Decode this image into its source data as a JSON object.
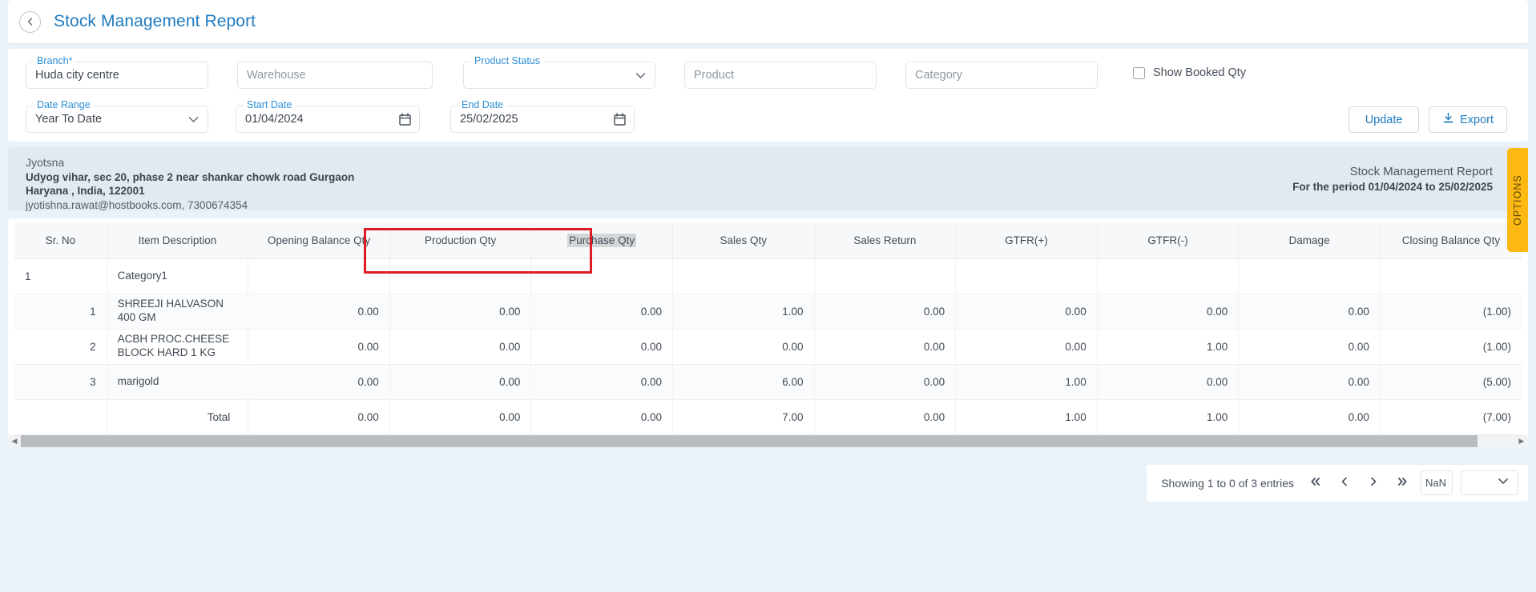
{
  "header": {
    "title": "Stock Management Report",
    "back_icon": "chevron-left-icon"
  },
  "filters": {
    "branch": {
      "label": "Branch",
      "required": "*",
      "value": "Huda city centre"
    },
    "warehouse": {
      "placeholder": "Warehouse",
      "value": ""
    },
    "product_status": {
      "label": "Product Status",
      "value": ""
    },
    "product": {
      "placeholder": "Product",
      "value": ""
    },
    "category": {
      "placeholder": "Category",
      "value": ""
    },
    "date_range": {
      "label": "Date Range",
      "value": "Year To Date"
    },
    "start_date": {
      "label": "Start Date",
      "value": "01/04/2024"
    },
    "end_date": {
      "label": "End Date",
      "value": "25/02/2025"
    },
    "show_booked_qty": {
      "label": "Show Booked Qty",
      "checked": false
    },
    "update_button": "Update",
    "export_button": "Export"
  },
  "options_tab": {
    "label": "OPTIONS"
  },
  "company": {
    "name": "Jyotsna",
    "address_line1": "Udyog vihar, sec 20, phase 2 near shankar chowk road Gurgaon",
    "address_line2": "Haryana , India, 122001",
    "contact": "jyotishna.rawat@hostbooks.com, 7300674354",
    "report_title": "Stock Management Report",
    "report_period": "For the period 01/04/2024 to 25/02/2025"
  },
  "table": {
    "columns": [
      "Sr. No",
      "Item Description",
      "Opening Balance Qty",
      "Production Qty",
      "Purchase Qty",
      "Sales Qty",
      "Sales Return",
      "GTFR(+)",
      "GTFR(-)",
      "Damage",
      "Closing Balance Qty"
    ],
    "highlighted_column": "Purchase Qty",
    "rows": [
      {
        "type": "group",
        "sr": "1",
        "desc": "Category1",
        "values": [
          "",
          "",
          "",
          "",
          "",
          "",
          "",
          "",
          ""
        ]
      },
      {
        "type": "item",
        "sr": "1",
        "desc": "SHREEJI HALVASON 400 GM",
        "values": [
          "0.00",
          "0.00",
          "0.00",
          "1.00",
          "0.00",
          "0.00",
          "0.00",
          "0.00",
          "(1.00)"
        ]
      },
      {
        "type": "item",
        "sr": "2",
        "desc": "ACBH PROC.CHEESE BLOCK HARD 1 KG",
        "values": [
          "0.00",
          "0.00",
          "0.00",
          "0.00",
          "0.00",
          "0.00",
          "1.00",
          "0.00",
          "(1.00)"
        ]
      },
      {
        "type": "item",
        "sr": "3",
        "desc": "marigold",
        "values": [
          "0.00",
          "0.00",
          "0.00",
          "6.00",
          "0.00",
          "1.00",
          "0.00",
          "0.00",
          "(5.00)"
        ]
      }
    ],
    "total_row": {
      "label": "Total",
      "values": [
        "0.00",
        "0.00",
        "0.00",
        "7.00",
        "0.00",
        "1.00",
        "1.00",
        "0.00",
        "(7.00)"
      ]
    }
  },
  "pagination": {
    "showing": "Showing 1 to 0 of 3 entries",
    "first_icon": "double-chevron-left-icon",
    "prev_icon": "chevron-left-icon",
    "next_icon": "chevron-right-icon",
    "last_icon": "double-chevron-right-icon",
    "page_input_value": "NaN",
    "page_size_value": ""
  },
  "colors": {
    "accent": "#1e7bc0",
    "highlight_box": "#e01b24",
    "options_tab": "#fcb813",
    "page_bg": "#eaf2f8"
  }
}
